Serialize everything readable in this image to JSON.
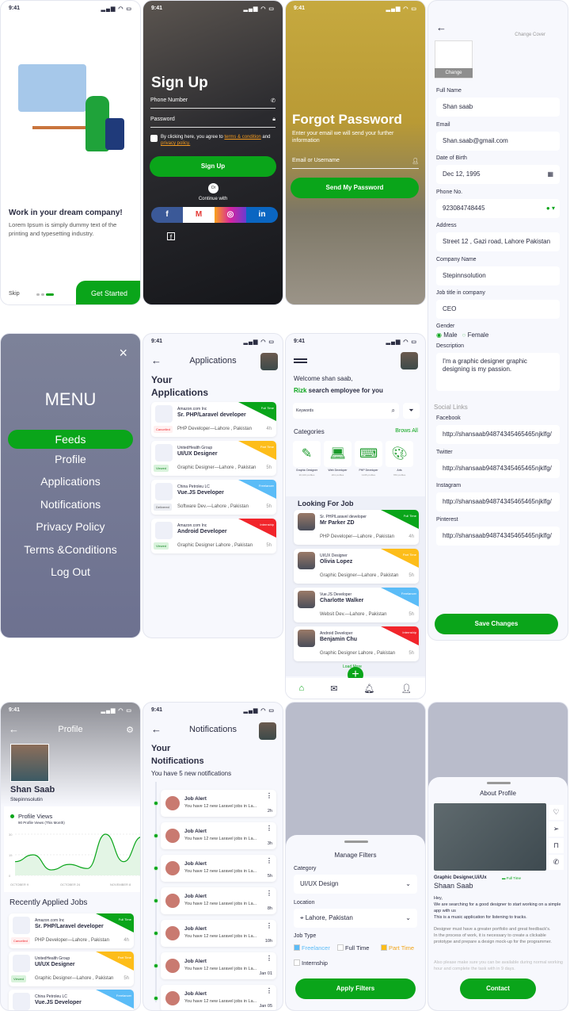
{
  "status": {
    "time": "9:41",
    "icons": "▂▄▆ ◠ ▭"
  },
  "colors": {
    "accent": "#0aa51a",
    "full_time": "#0aa51a",
    "part_time": "#fdbd1a",
    "freelancer": "#5bbcf7",
    "internship": "#f1252b"
  },
  "onboarding": {
    "title": "Work in your dream company!",
    "text": "Lorem Ipsum is simply dummy text of the printing and typesetting industry.",
    "skip": "Skip",
    "cta": "Get Started"
  },
  "signup": {
    "title": "Sign Up",
    "phone_placeholder": "Phone Number",
    "password_placeholder": "Password",
    "agree_prefix": "By clicking here, you agree to ",
    "terms": "terms & condition",
    "and": " and ",
    "privacy": "privacy policy.",
    "button": "Sign Up",
    "or": "Or",
    "continue": "Continue with",
    "social": [
      {
        "name": "facebook",
        "glyph": "f"
      },
      {
        "name": "gmail",
        "glyph": "M"
      },
      {
        "name": "instagram",
        "glyph": "◎"
      },
      {
        "name": "linkedin",
        "glyph": "in"
      }
    ]
  },
  "forgot": {
    "title": "Forgot Password",
    "text": "Enter your email we will send your further information",
    "email_placeholder": "Email or Username",
    "button": "Send My Password"
  },
  "edit": {
    "change_cover": "Change Cover",
    "change": "Change",
    "fields": [
      {
        "label": "Full Name",
        "value": "Shan saab"
      },
      {
        "label": "Email",
        "value": "Shan.saab@gmail.com"
      },
      {
        "label": "Date of Birth",
        "value": "Dec 12, 1995"
      },
      {
        "label": "Phone No.",
        "value": "923084748445"
      },
      {
        "label": "Address",
        "value": "Street 12 , Gazi road, Lahore Pakistan"
      },
      {
        "label": "Company Name",
        "value": "Stepinnsolution"
      },
      {
        "label": "Job title in company",
        "value": "CEO"
      }
    ],
    "gender_label": "Gender",
    "male": "Male",
    "female": "Female",
    "description_label": "Description",
    "description": "I'm a graphic designer graphic designing is my passion.",
    "social_heading": "Social Links",
    "social": [
      {
        "label": "Facebook",
        "value": "http://shansaab94874345465465njklfg/"
      },
      {
        "label": "Twitter",
        "value": "http://shansaab94874345465465njklfg/"
      },
      {
        "label": "Instagram",
        "value": "http://shansaab94874345465465njklfg/"
      },
      {
        "label": "Pinterest",
        "value": "http://shansaab94874345465465njklfg/"
      }
    ],
    "save": "Save Changes"
  },
  "menu": {
    "title": "MENU",
    "items": [
      "Feeds",
      "Profile",
      "Applications",
      "Notifications",
      "Privacy Policy",
      "Terms &Conditions",
      "Log Out"
    ],
    "active": "Feeds"
  },
  "applications": {
    "header": "Applications",
    "title": "Your Applications",
    "items": [
      {
        "company": "Amazon.com Inc",
        "title": "Sr. PHP/Laravel developer",
        "status": "Cancelled",
        "location": "PHP Developer—Lahore , Pakistan",
        "time": "4h",
        "type": "Full Time"
      },
      {
        "company": "UnitedHealth Group",
        "title": "UI/UX Designer",
        "status": "Viewed",
        "location": "Graphic Designer—Lahore , Pakistan",
        "time": "5h",
        "type": "Part Time"
      },
      {
        "company": "China Petroleu LC",
        "title": "Vue.JS Developer",
        "status": "Delivered",
        "location": "Software Dev.—Lahore , Pakistan",
        "time": "5h",
        "type": "Freelancer"
      },
      {
        "company": "Amazon.com Inc",
        "title": "Android Developer",
        "status": "Viewed",
        "location": "Graphic Designer  Lahore , Pakistan",
        "time": "5h",
        "type": "Internship"
      }
    ]
  },
  "home": {
    "welcome": "Welcome shan saab,",
    "brand": "Rizk",
    "tagline": " search employee for you",
    "search_value": "Keywords",
    "categories_title": "Categories",
    "browse_all": "Brows All",
    "categories": [
      {
        "name": "Graphic Designer",
        "count": "20,100 profiles"
      },
      {
        "name": "Web Developer",
        "count": "204 profiles"
      },
      {
        "name": "PHP Developer",
        "count": "1245 profiles"
      },
      {
        "name": "Arts",
        "count": "780 profiles"
      }
    ],
    "looking_title": "Looking For Job",
    "load_more": "Load More",
    "people": [
      {
        "role": "Sr. PHP/Laravel developer",
        "name": "Mr Parker ZD",
        "location": "PHP Developer—Lahore , Pakistan",
        "time": "4h",
        "type": "Full Time"
      },
      {
        "role": "UI/UX Designer",
        "name": "Olivia Lopez",
        "location": "Graphic Designer—Lahore , Pakistan",
        "time": "5h",
        "type": "Part Time"
      },
      {
        "role": "Vue.JS Developer",
        "name": "Charlotte Walker",
        "location": "Websit Dev.—Lahore , Pakistan",
        "time": "5h",
        "type": "Freelancer"
      },
      {
        "role": "Android Developer",
        "name": "Benjamin Chu",
        "location": "Graphic Designer  Lahore , Pakistan",
        "time": "5h",
        "type": "Internship"
      }
    ],
    "nav": [
      "home-icon",
      "mail-icon",
      "bell-icon",
      "user-icon"
    ]
  },
  "profile": {
    "header": "Profile",
    "name": "Shan Saab",
    "company": "Stepinnsolutin",
    "views_title": "Profile Views",
    "views_sub": "90 Profile Views (This Month)",
    "chart": {
      "type": "line",
      "y_ticks": [
        "30",
        "15",
        "0"
      ],
      "x_labels": [
        "OCTOBER 9",
        "OCTOBER 24",
        "NOVEMBER 8"
      ],
      "ylim": [
        0,
        30
      ],
      "values": [
        10,
        15,
        4,
        8,
        5,
        30,
        10,
        28
      ]
    },
    "recent_title": "Recently Applied Jobs"
  },
  "notifications": {
    "header": "Notifications",
    "title": "Your Notifications",
    "subtitle": "You have 5 new notifications",
    "items": [
      {
        "title": "Job Alert",
        "text": "You have 12 new Laravel jobs in La...",
        "time": "2h"
      },
      {
        "title": "Job Alert",
        "text": "You have 12 new Laravel jobs in La...",
        "time": "3h"
      },
      {
        "title": "Job Alert",
        "text": "You have 12 new Laravel jobs in La...",
        "time": "5h"
      },
      {
        "title": "Job Alert",
        "text": "You have 12 new Laravel jobs in La...",
        "time": "8h"
      },
      {
        "title": "Job Alert",
        "text": "You have 12 new Laravel jobs in La...",
        "time": "10h"
      },
      {
        "title": "Job Alert",
        "text": "You have 12 new Laravel jobs in La...",
        "time": "Jan 01"
      },
      {
        "title": "Job Alert",
        "text": "You have 12 new Laravel jobs in La...",
        "time": "Jan 05"
      }
    ]
  },
  "filters": {
    "title": "Manage Filters",
    "category_label": "Category",
    "category": "UI/UX Design",
    "location_label": "Location",
    "location": "Lahore, Pakistan",
    "jobtype_label": "Job Type",
    "types": [
      {
        "label": "Freelancer",
        "checked": true
      },
      {
        "label": "Full Time",
        "checked": false
      },
      {
        "label": "Part Time",
        "checked": true
      },
      {
        "label": "Internship",
        "checked": false
      }
    ],
    "apply": "Apply Filters"
  },
  "about": {
    "title": "About Profile",
    "role": "Graphic Designer,Ui/Ux",
    "badge": "Full Time",
    "name": "Shaan Saab",
    "p1": "Hey,\nWe are searching for a good designer to start working on a simple app with us\nThis is a music application for listening to tracks.",
    "p2": "Designer must have a greater portfolio and great feedback's.\nIn the process of work, it is necessary to create a clickable prototype and prepare a design mock-up for the programmer.",
    "p3": "Also please make sure you can be available during normal working hour and complete the task with in 9 days.",
    "contact": "Contact"
  }
}
